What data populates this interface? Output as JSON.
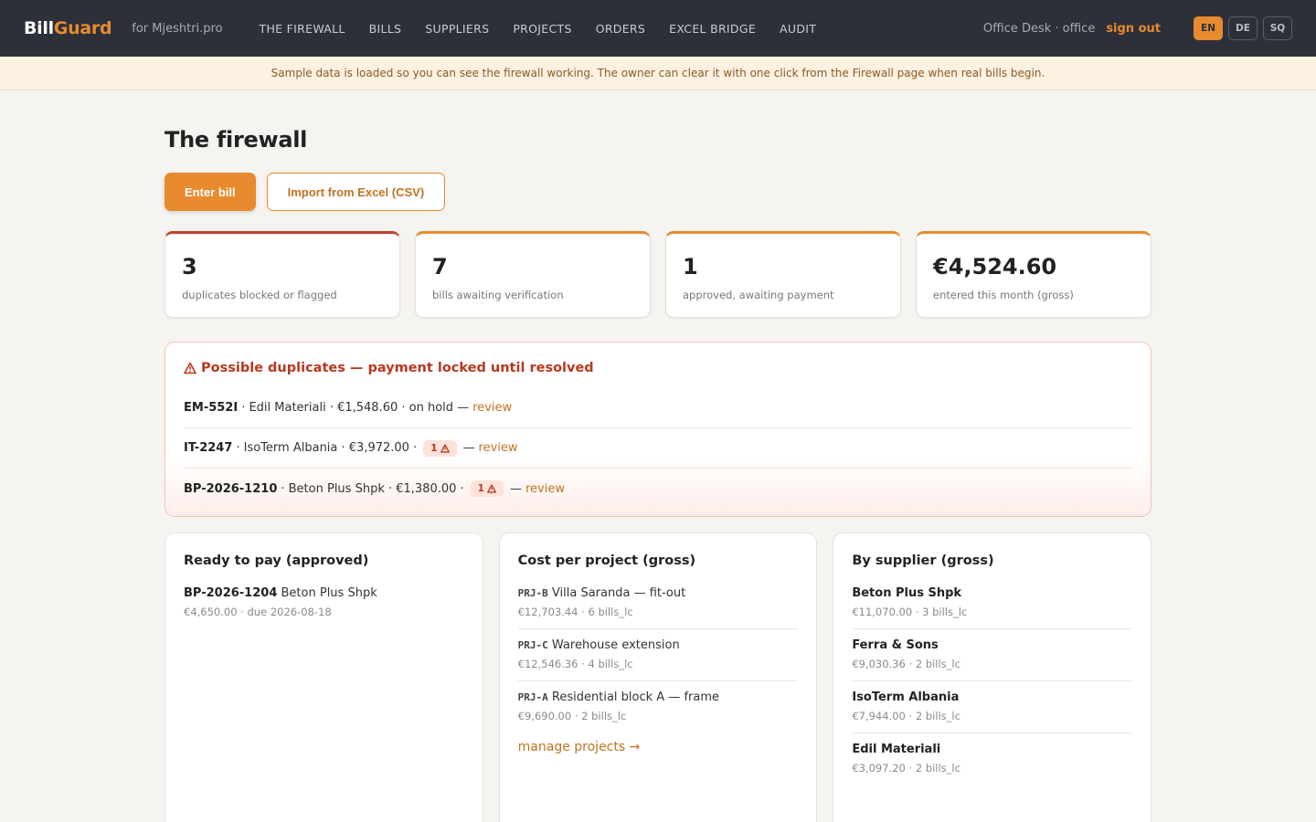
{
  "brand": {
    "part1": "Bill",
    "part2": "Guard"
  },
  "tenant": "for Mjeshtri.pro",
  "nav": [
    "THE FIREWALL",
    "BILLS",
    "SUPPLIERS",
    "PROJECTS",
    "ORDERS",
    "EXCEL BRIDGE",
    "AUDIT"
  ],
  "user": "Office Desk · office",
  "signout": "sign out",
  "languages": [
    "EN",
    "DE",
    "SQ"
  ],
  "active_language": "EN",
  "banner": "Sample data is loaded so you can see the firewall working. The owner can clear it with one click from the Firewall page when real bills begin.",
  "page_title": "The firewall",
  "actions": {
    "enter_bill": "Enter bill",
    "import_csv": "Import from Excel (CSV)"
  },
  "stats": [
    {
      "value": "3",
      "label": "duplicates blocked or flagged"
    },
    {
      "value": "7",
      "label": "bills awaiting verification"
    },
    {
      "value": "1",
      "label": "approved, awaiting payment"
    },
    {
      "value": "€4,524.60",
      "label": "entered this month (gross)"
    }
  ],
  "duplicates": {
    "title": "Possible duplicates — payment locked until resolved",
    "review_label": "review",
    "rows": [
      {
        "code": "EM-552I",
        "text": "· Edil Materiali · €1,548.60 · on hold —",
        "badge": ""
      },
      {
        "code": "IT-2247",
        "text": "· IsoTerm Albania · €3,972.00 ·",
        "badge": "1"
      },
      {
        "code": "BP-2026-1210",
        "text": "· Beton Plus Shpk · €1,380.00 ·",
        "badge": "1"
      }
    ],
    "dash": "—"
  },
  "ready_to_pay": {
    "title": "Ready to pay (approved)",
    "items": [
      {
        "code": "BP-2026-1204",
        "name": "Beton Plus Shpk",
        "sub": "€4,650.00 · due 2026-08-18"
      }
    ]
  },
  "cost_per_project": {
    "title": "Cost per project (gross)",
    "items": [
      {
        "code": "PRJ-B",
        "name": "Villa Saranda — fit-out",
        "sub": "€12,703.44 · 6 bills_lc"
      },
      {
        "code": "PRJ-C",
        "name": "Warehouse extension",
        "sub": "€12,546.36 · 4 bills_lc"
      },
      {
        "code": "PRJ-A",
        "name": "Residential block A — frame",
        "sub": "€9,690.00 · 2 bills_lc"
      }
    ],
    "manage_link": "manage projects →"
  },
  "by_supplier": {
    "title": "By supplier (gross)",
    "items": [
      {
        "name": "Beton Plus Shpk",
        "sub": "€11,070.00 · 3 bills_lc"
      },
      {
        "name": "Ferra & Sons",
        "sub": "€9,030.36 · 2 bills_lc"
      },
      {
        "name": "IsoTerm Albania",
        "sub": "€7,944.00 · 2 bills_lc"
      },
      {
        "name": "Edil Materiali",
        "sub": "€3,097.20 · 2 bills_lc"
      }
    ]
  }
}
